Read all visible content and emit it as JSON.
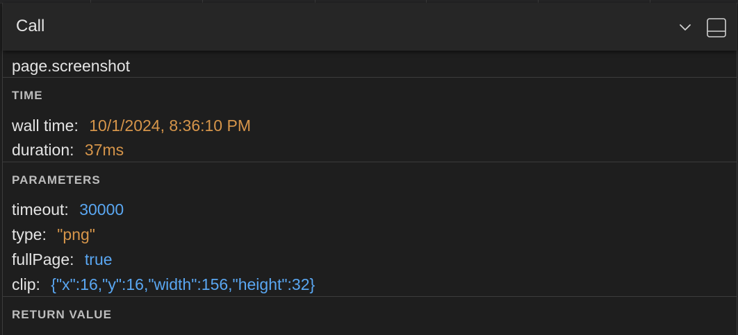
{
  "header": {
    "title": "Call",
    "expand_icon": "chevron-down-icon",
    "dock_icon": "panel-layout-icon"
  },
  "call": {
    "method": "page.screenshot"
  },
  "time": {
    "heading": "TIME",
    "wall_time_label": "wall time:",
    "wall_time_value": "10/1/2024, 8:36:10 PM",
    "duration_label": "duration:",
    "duration_value": "37ms"
  },
  "parameters": {
    "heading": "PARAMETERS",
    "items": [
      {
        "label": "timeout:",
        "value": "30000"
      },
      {
        "label": "type:",
        "value": "\"png\""
      },
      {
        "label": "fullPage:",
        "value": "true"
      },
      {
        "label": "clip:",
        "value": "{\"x\":16,\"y\":16,\"width\":156,\"height\":32}"
      }
    ]
  },
  "return_value": {
    "heading": "RETURN VALUE"
  },
  "colors": {
    "string_value": "#d6954a",
    "literal_value": "#5aa7f2",
    "background": "#1e1e1e",
    "header_background": "#262626"
  }
}
